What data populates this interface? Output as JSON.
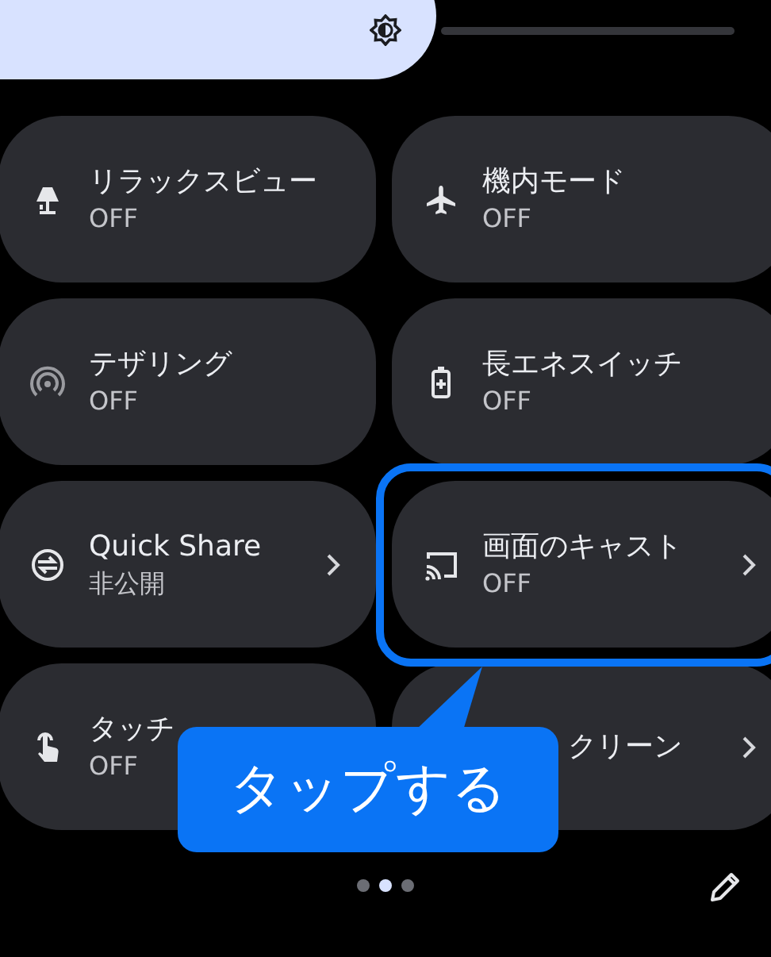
{
  "tiles": [
    {
      "title": "リラックスビュー",
      "subtitle": "OFF",
      "kind": "toggle"
    },
    {
      "title": "機内モード",
      "subtitle": "OFF",
      "kind": "toggle"
    },
    {
      "title": "テザリング",
      "subtitle": "OFF",
      "kind": "toggle"
    },
    {
      "title": "長エネスイッチ",
      "subtitle": "OFF",
      "kind": "toggle"
    },
    {
      "title": "Quick Share",
      "subtitle": "非公開",
      "kind": "detail"
    },
    {
      "title": "画面のキャスト",
      "subtitle": "OFF",
      "kind": "detail"
    },
    {
      "title": "タッチ",
      "subtitle": "OFF",
      "kind": "toggle"
    },
    {
      "title": "クリーン",
      "kind": "detail"
    }
  ],
  "pages": [
    {
      "selected": false
    },
    {
      "selected": true
    },
    {
      "selected": false
    }
  ],
  "annotation": {
    "text": "タップする"
  }
}
